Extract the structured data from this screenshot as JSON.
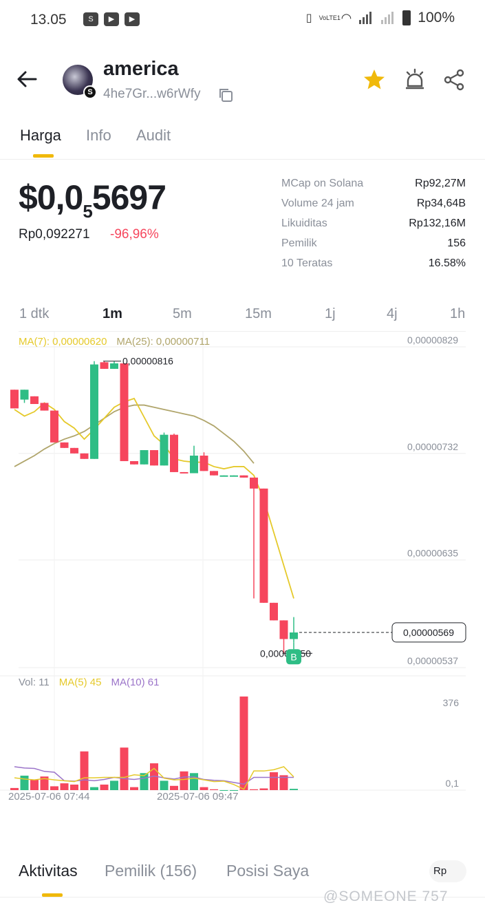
{
  "status_bar": {
    "time": "13.05",
    "network_label": "VoLTE1",
    "battery": "100%"
  },
  "header": {
    "token_name": "america",
    "token_address": "4he7Gr...w6rWfy",
    "chain_badge": "S"
  },
  "tabs": [
    {
      "label": "Harga",
      "active": true
    },
    {
      "label": "Info",
      "active": false
    },
    {
      "label": "Audit",
      "active": false
    }
  ],
  "price": {
    "main_prefix": "$0,0",
    "main_subscript": "5",
    "main_suffix": "5697",
    "idr": "Rp0,092271",
    "change": "-96,96%"
  },
  "stats": [
    {
      "label": "MCap on Solana",
      "value": "Rp92,27M"
    },
    {
      "label": "Volume 24 jam",
      "value": "Rp34,64B"
    },
    {
      "label": "Likuiditas",
      "value": "Rp132,16M"
    },
    {
      "label": "Pemilik",
      "value": "156"
    },
    {
      "label": "10 Teratas",
      "value": "16.58%"
    }
  ],
  "intervals": [
    {
      "label": "1 dtk",
      "active": false
    },
    {
      "label": "1m",
      "active": true
    },
    {
      "label": "5m",
      "active": false
    },
    {
      "label": "15m",
      "active": false
    },
    {
      "label": "1j",
      "active": false
    },
    {
      "label": "4j",
      "active": false
    },
    {
      "label": "1h",
      "active": false
    }
  ],
  "ma_legend": {
    "ma7": "MA(7): 0,00000620",
    "ma25": "MA(25): 0,00000711"
  },
  "volume_legend": {
    "vol": "Vol: 11",
    "ma5": "MA(5) 45",
    "ma10": "MA(10) 61"
  },
  "x_axis": [
    "2025-07-06 07:44",
    "2025-07-06 09:47"
  ],
  "colors": {
    "up": "#2ebd85",
    "down": "#f6465d",
    "ma7": "#e5c92a",
    "ma25": "#b0a56b",
    "ma10": "#9b74c9",
    "accent": "#f0b90b"
  },
  "chart_data": {
    "type": "candlestick",
    "price_axis_labels": [
      "0,00000829",
      "0,00000732",
      "0,00000635",
      "0,00000537"
    ],
    "ylim": [
      5.37e-06,
      8.29e-06
    ],
    "high_label": "0,00000816",
    "low_label": "0,00000550",
    "current_label": "0,00000569",
    "marker_label": "B",
    "candles": [
      {
        "o": 7.9,
        "c": 7.73,
        "h": 7.9,
        "l": 7.73
      },
      {
        "o": 7.81,
        "c": 7.9,
        "h": 7.9,
        "l": 7.78
      },
      {
        "o": 7.84,
        "c": 7.77,
        "h": 7.84,
        "l": 7.77
      },
      {
        "o": 7.78,
        "c": 7.71,
        "h": 7.78,
        "l": 7.71
      },
      {
        "o": 7.71,
        "c": 7.42,
        "h": 7.71,
        "l": 7.42
      },
      {
        "o": 7.42,
        "c": 7.37,
        "h": 7.42,
        "l": 7.37
      },
      {
        "o": 7.37,
        "c": 7.32,
        "h": 7.37,
        "l": 7.32
      },
      {
        "o": 7.32,
        "c": 7.27,
        "h": 7.32,
        "l": 7.27
      },
      {
        "o": 7.27,
        "c": 8.13,
        "h": 8.16,
        "l": 7.27
      },
      {
        "o": 8.15,
        "c": 8.09,
        "h": 8.16,
        "l": 8.09
      },
      {
        "o": 8.09,
        "c": 8.14,
        "h": 8.16,
        "l": 8.09
      },
      {
        "o": 8.14,
        "c": 7.25,
        "h": 8.14,
        "l": 7.25
      },
      {
        "o": 7.25,
        "c": 7.22,
        "h": 7.25,
        "l": 7.22
      },
      {
        "o": 7.22,
        "c": 7.35,
        "h": 7.35,
        "l": 7.22
      },
      {
        "o": 7.35,
        "c": 7.21,
        "h": 7.35,
        "l": 7.21
      },
      {
        "o": 7.21,
        "c": 7.49,
        "h": 7.51,
        "l": 7.21
      },
      {
        "o": 7.49,
        "c": 7.15,
        "h": 7.5,
        "l": 7.15
      },
      {
        "o": 7.15,
        "c": 7.14,
        "h": 7.15,
        "l": 7.14
      },
      {
        "o": 7.14,
        "c": 7.3,
        "h": 7.39,
        "l": 7.14
      },
      {
        "o": 7.3,
        "c": 7.16,
        "h": 7.33,
        "l": 7.16
      },
      {
        "o": 7.16,
        "c": 7.12,
        "h": 7.16,
        "l": 7.12
      },
      {
        "o": 7.12,
        "c": 7.12,
        "h": 7.12,
        "l": 7.11
      },
      {
        "o": 7.12,
        "c": 7.12,
        "h": 7.12,
        "l": 7.11
      },
      {
        "o": 7.12,
        "c": 7.1,
        "h": 7.12,
        "l": 7.1
      },
      {
        "o": 7.1,
        "c": 7.0,
        "h": 7.1,
        "l": 6.0
      },
      {
        "o": 7.0,
        "c": 5.96,
        "h": 7.0,
        "l": 5.96
      },
      {
        "o": 5.96,
        "c": 5.8,
        "h": 5.96,
        "l": 5.8
      },
      {
        "o": 5.8,
        "c": 5.63,
        "h": 5.8,
        "l": 5.5
      },
      {
        "o": 5.63,
        "c": 5.69,
        "h": 5.83,
        "l": 5.6
      }
    ],
    "ma7": [
      7.72,
      7.66,
      7.7,
      7.78,
      7.72,
      7.61,
      7.55,
      7.45,
      7.54,
      7.64,
      7.74,
      7.79,
      7.82,
      7.65,
      7.48,
      7.4,
      7.27,
      7.25,
      7.24,
      7.24,
      7.2,
      7.18,
      7.2,
      7.2,
      7.12,
      6.9,
      6.6,
      6.3,
      6.0
    ],
    "ma25": [
      7.2,
      7.25,
      7.3,
      7.36,
      7.41,
      7.45,
      7.48,
      7.52,
      7.58,
      7.64,
      7.7,
      7.74,
      7.76,
      7.76,
      7.74,
      7.72,
      7.7,
      7.68,
      7.66,
      7.62,
      7.57,
      7.5,
      7.43,
      7.34,
      7.23
    ],
    "volume": [
      5,
      34,
      25,
      32,
      9,
      16,
      13,
      91,
      7,
      13,
      22,
      100,
      7,
      40,
      63,
      22,
      10,
      44,
      40,
      7,
      2,
      0,
      0,
      220,
      2,
      4,
      42,
      35,
      3
    ],
    "volume_axis_labels": [
      "376",
      "0,1"
    ],
    "vol_ma5": [
      29,
      26,
      24,
      27,
      24,
      22,
      20,
      29,
      29,
      30,
      30,
      30,
      36,
      34,
      51,
      28,
      24,
      25,
      28,
      24,
      20,
      21,
      13,
      2,
      45,
      45,
      48,
      55,
      31
    ],
    "vol_ma10": [
      55,
      52,
      51,
      44,
      42,
      22,
      21,
      24,
      22,
      25,
      30,
      27,
      25,
      28,
      33,
      29,
      26,
      31,
      31,
      25,
      23,
      22,
      18,
      14,
      30,
      30,
      30,
      30,
      30
    ]
  },
  "bottom_tabs": [
    {
      "label": "Aktivitas",
      "active": true
    },
    {
      "label": "Pemilik (156)",
      "active": false
    },
    {
      "label": "Posisi Saya",
      "active": false
    }
  ],
  "currency_toggle": "Rp",
  "watermark": "@SOMEONE 757"
}
